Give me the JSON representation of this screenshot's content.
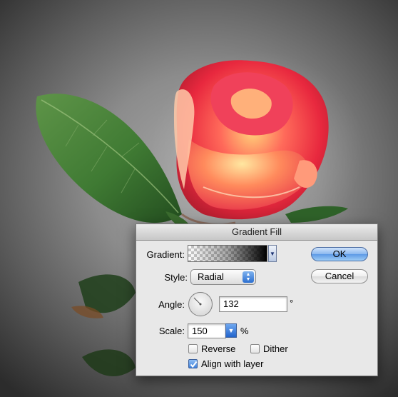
{
  "dialog": {
    "title": "Gradient Fill",
    "gradient_label": "Gradient:",
    "style_label": "Style:",
    "style_value": "Radial",
    "angle_label": "Angle:",
    "angle_value": "132",
    "angle_unit": "°",
    "scale_label": "Scale:",
    "scale_value": "150",
    "scale_unit": "%",
    "reverse_label": "Reverse",
    "reverse_checked": false,
    "dither_label": "Dither",
    "dither_checked": false,
    "align_label": "Align with layer",
    "align_checked": true,
    "ok_label": "OK",
    "cancel_label": "Cancel"
  },
  "colors": {
    "accent": "#3e7fd8",
    "dialog_bg": "#e8e8e8"
  }
}
